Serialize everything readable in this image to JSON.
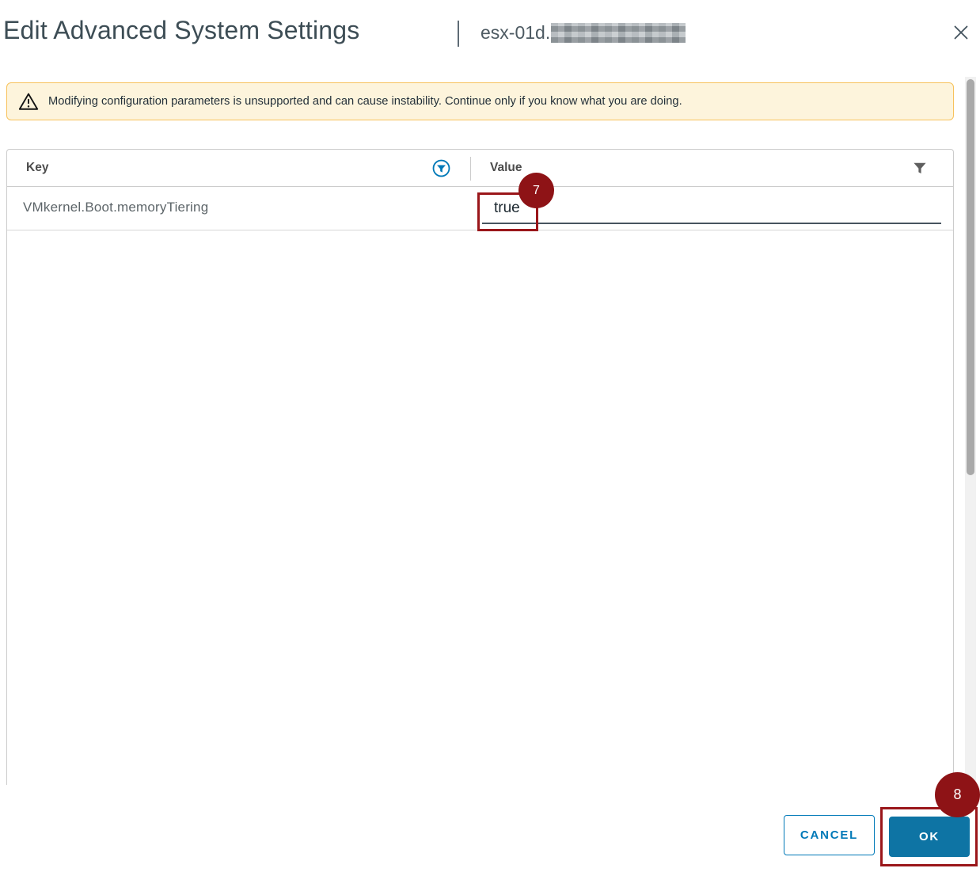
{
  "dialog": {
    "title": "Edit Advanced System Settings",
    "hostname_prefix": "esx-01d.",
    "hostname_redacted": true
  },
  "warning": {
    "text": "Modifying configuration parameters is unsupported and can cause instability. Continue only if you know what you are doing."
  },
  "table": {
    "columns": [
      {
        "label": "Key",
        "filter_icon": "filter-active-circle-icon"
      },
      {
        "label": "Value",
        "filter_icon": "filter-funnel-icon"
      }
    ],
    "rows": [
      {
        "key": "VMkernel.Boot.memoryTiering",
        "value": "true"
      }
    ]
  },
  "annotations": {
    "steps": [
      {
        "number": "7",
        "target": "value-input"
      },
      {
        "number": "8",
        "target": "ok-button"
      }
    ]
  },
  "footer": {
    "cancel_label": "CANCEL",
    "ok_label": "OK"
  },
  "icons": {
    "close": "x-icon",
    "warning": "warning-triangle-icon",
    "key_filter": "filter-active-circle-icon",
    "value_filter": "filter-funnel-icon"
  },
  "colors": {
    "accent_blue": "#0079b8",
    "primary_button_bg": "#0e74a4",
    "warning_bg": "#fdf4dc",
    "warning_border": "#f7c25c",
    "annotation_red": "#8e1316",
    "title_text": "#3d4d55"
  }
}
